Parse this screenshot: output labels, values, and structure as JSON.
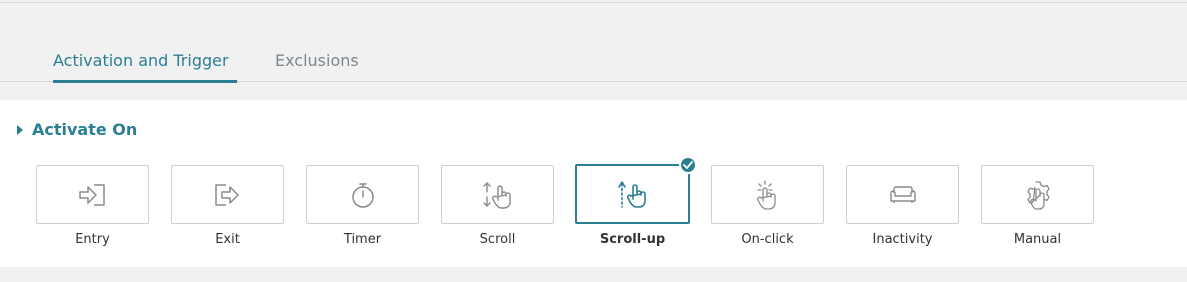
{
  "tabs": [
    {
      "label": "Activation and Trigger",
      "active": true
    },
    {
      "label": "Exclusions",
      "active": false
    }
  ],
  "section": {
    "title": "Activate On"
  },
  "options": [
    {
      "label": "Entry",
      "icon": "entry-icon",
      "selected": false
    },
    {
      "label": "Exit",
      "icon": "exit-icon",
      "selected": false
    },
    {
      "label": "Timer",
      "icon": "timer-icon",
      "selected": false
    },
    {
      "label": "Scroll",
      "icon": "scroll-icon",
      "selected": false
    },
    {
      "label": "Scroll-up",
      "icon": "scroll-up-icon",
      "selected": true
    },
    {
      "label": "On-click",
      "icon": "on-click-icon",
      "selected": false
    },
    {
      "label": "Inactivity",
      "icon": "sofa-icon",
      "selected": false
    },
    {
      "label": "Manual",
      "icon": "manual-gear-icon",
      "selected": false
    }
  ],
  "colors": {
    "accent": "#2a7f95",
    "icon": "#8a8a8a",
    "border": "#cfcfcf"
  }
}
